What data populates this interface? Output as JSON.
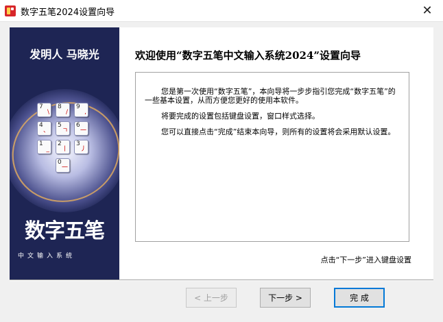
{
  "window": {
    "title": "数字五笔2024设置向导",
    "close_glyph": "✕"
  },
  "sidebar": {
    "inventor": "发明人 马晓光",
    "brand": "数字五笔",
    "subtitle": "中文输入系统",
    "keypad": [
      {
        "num": "7",
        "mark": "\\"
      },
      {
        "num": "8",
        "mark": "/"
      },
      {
        "num": "9",
        "mark": ","
      },
      {
        "num": "4",
        "mark": "、"
      },
      {
        "num": "5",
        "mark": "ㄱ"
      },
      {
        "num": "6",
        "mark": "一"
      },
      {
        "num": "1",
        "mark": "_"
      },
      {
        "num": "2",
        "mark": "丨"
      },
      {
        "num": "3",
        "mark": "丿"
      },
      {
        "num": "0",
        "mark": "一"
      }
    ]
  },
  "content": {
    "heading": "欢迎使用“数字五笔中文输入系统2024”设置向导",
    "paragraphs": [
      "您是第一次使用“数字五笔”，本向导将一步步指引您完成“数字五笔”的一些基本设置，从而方便您更好的使用本软件。",
      "将要完成的设置包括键盘设置，窗口样式选择。",
      "您可以直接点击“完成”结束本向导，则所有的设置将会采用默认设置。"
    ],
    "hint": "点击“下一步”进入键盘设置"
  },
  "buttons": {
    "prev": "< 上一步",
    "next": "下一步 >",
    "finish": "完 成"
  }
}
